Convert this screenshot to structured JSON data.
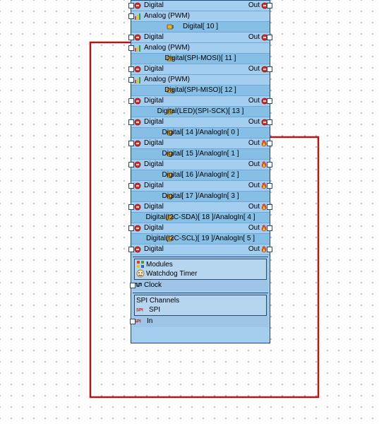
{
  "rows": [
    {
      "type": "dig",
      "in": true,
      "label": "Digital",
      "out": "Out",
      "outIconR": true
    },
    {
      "type": "ana",
      "label": "Analog (PWM)"
    },
    {
      "type": "hdr",
      "center": "Digital[ 10 ]"
    },
    {
      "type": "dig",
      "in": true,
      "label": "Digital",
      "out": "Out",
      "outIconR": true
    },
    {
      "type": "ana",
      "label": "Analog (PWM)"
    },
    {
      "type": "hdr",
      "center": "Digital(SPI-MOSI)[ 11 ]"
    },
    {
      "type": "dig",
      "in": true,
      "label": "Digital",
      "out": "Out",
      "outIconR": true
    },
    {
      "type": "ana",
      "label": "Analog (PWM)"
    },
    {
      "type": "hdr",
      "center": "Digital(SPI-MISO)[ 12 ]"
    },
    {
      "type": "dig",
      "in": true,
      "label": "Digital",
      "out": "Out",
      "outIconR": true
    },
    {
      "type": "hdr",
      "center": "Digital(LED)(SPI-SCK)[ 13 ]"
    },
    {
      "type": "dig",
      "in": true,
      "label": "Digital",
      "out": "Out",
      "outIconR": true
    },
    {
      "type": "hdr",
      "center": "Digital[ 14 ]/AnalogIn[ 0 ]"
    },
    {
      "type": "dig",
      "in": true,
      "label": "Digital",
      "out": "Out",
      "fire": true
    },
    {
      "type": "hdr",
      "center": "Digital[ 15 ]/AnalogIn[ 1 ]"
    },
    {
      "type": "dig",
      "in": true,
      "label": "Digital",
      "out": "Out",
      "fire": true
    },
    {
      "type": "hdr",
      "center": "Digital[ 16 ]/AnalogIn[ 2 ]"
    },
    {
      "type": "dig",
      "in": true,
      "label": "Digital",
      "out": "Out",
      "fire": true
    },
    {
      "type": "hdr",
      "center": "Digital[ 17 ]/AnalogIn[ 3 ]"
    },
    {
      "type": "dig",
      "in": true,
      "label": "Digital",
      "out": "Out",
      "fire": true
    },
    {
      "type": "hdr",
      "center": "Digital(I2C-SDA)[ 18 ]/AnalogIn[ 4 ]"
    },
    {
      "type": "dig",
      "in": true,
      "label": "Digital",
      "out": "Out",
      "fire": true
    },
    {
      "type": "hdr",
      "center": "Digital(I2C-SCL)[ 19 ]/AnalogIn[ 5 ]"
    },
    {
      "type": "dig",
      "in": true,
      "label": "Digital",
      "out": "Out",
      "fire": true
    }
  ],
  "bottom1": {
    "items": [
      "Modules",
      "Watchdog Timer"
    ],
    "clock": "Clock"
  },
  "bottom2": {
    "title": "SPI Channels",
    "items": [
      "SPI"
    ],
    "inlbl": "In",
    "spiTag": "SPI"
  }
}
